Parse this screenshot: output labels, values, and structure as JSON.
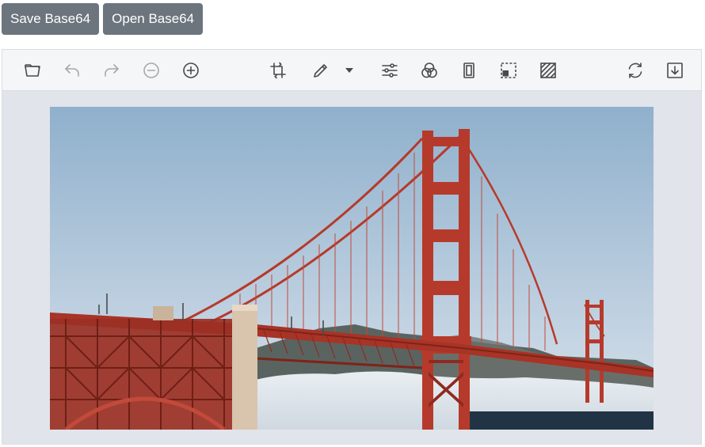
{
  "buttons": {
    "save_base64": "Save Base64",
    "open_base64": "Open Base64"
  },
  "toolbar": {
    "items": [
      {
        "icon": "folder-open-icon"
      },
      {
        "icon": "undo-icon"
      },
      {
        "icon": "redo-icon"
      },
      {
        "icon": "zoom-out-icon"
      },
      {
        "icon": "zoom-in-icon"
      },
      {
        "icon": "crop-icon"
      },
      {
        "icon": "pencil-icon"
      },
      {
        "icon": "caret-down-icon"
      },
      {
        "icon": "adjustments-icon"
      },
      {
        "icon": "filters-icon"
      },
      {
        "icon": "frame-icon"
      },
      {
        "icon": "select-region-icon"
      },
      {
        "icon": "pattern-icon"
      },
      {
        "icon": "reset-icon"
      },
      {
        "icon": "download-icon"
      }
    ]
  },
  "image": {
    "subject": "Golden Gate Bridge",
    "colors": {
      "sky_top": "#8fb0cc",
      "sky_bottom": "#c7d6e4",
      "bridge": "#b63a2b",
      "fog": "#dfe6ec",
      "water": "#213446",
      "hills": "#596460"
    }
  },
  "colors": {
    "button_bg": "#6c757d",
    "toolbar_bg": "#f5f6f8",
    "canvas_bg": "#e1e4ea",
    "icon": "#4a4a4a"
  }
}
